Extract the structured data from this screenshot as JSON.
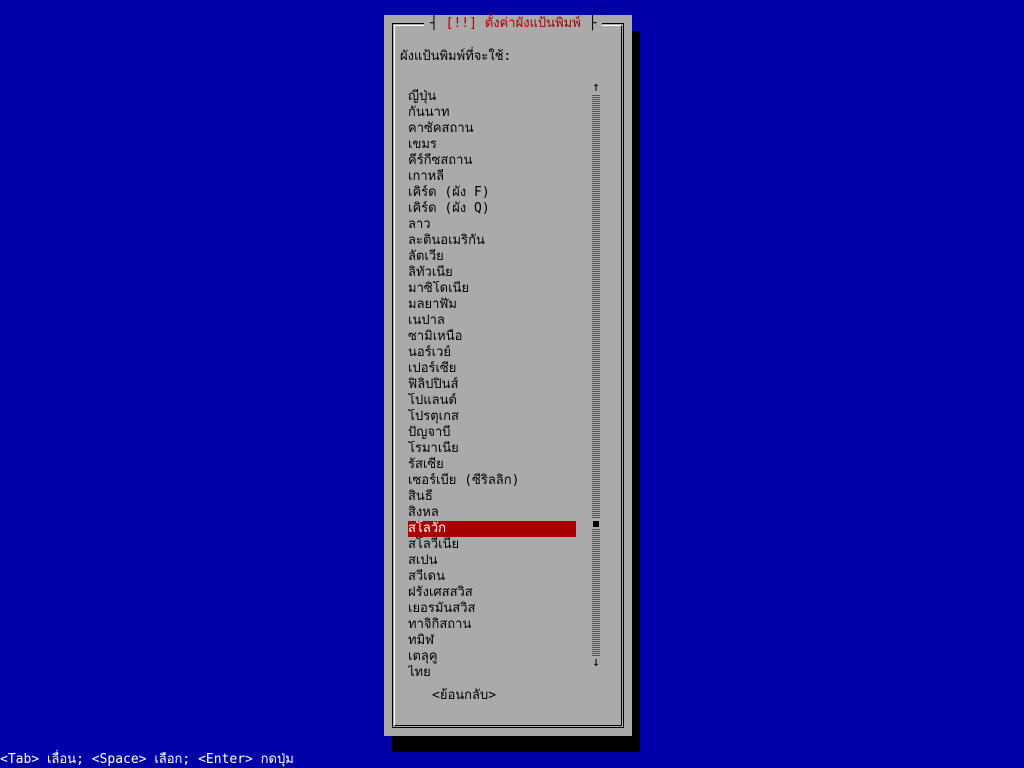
{
  "dialog": {
    "title_prefix": "[!!]",
    "title": "ตั้งค่าผังแป้นพิมพ์",
    "prompt": "ผังแป้นพิมพ์ที่จะใช้:",
    "items": [
      "ญี่ปุ่น",
      "กันนาท",
      "คาซัคสถาน",
      "เขมร",
      "คีร์กีซสถาน",
      "เกาหลี",
      "เคิร์ด (ผัง F)",
      "เคิร์ด (ผัง Q)",
      "ลาว",
      "ละตินอเมริกัน",
      "ลัตเวีย",
      "ลิทัวเนีย",
      "มาซิโดเนีย",
      "มลยาฬัม",
      "เนปาล",
      "ซามิเหนือ",
      "นอร์เวย์",
      "เปอร์เซีย",
      "ฟิลิปปินส์",
      "โปแลนด์",
      "โปรตุเกส",
      "ปัญจาบี",
      "โรมาเนีย",
      "รัสเซีย",
      "เซอร์เบีย (ซีริลลิก)",
      "สินธี",
      "สิงหล",
      "สโลวัก",
      "สโลวีเนีย",
      "สเปน",
      "สวีเดน",
      "ฝรั่งเศสสวิส",
      "เยอรมันสวิส",
      "ทาจิกิสถาน",
      "ทมิฬ",
      "เตลุคู",
      "ไทย"
    ],
    "selected_index": 27,
    "back_label": "<ย้อนกลับ>"
  },
  "scrollbar": {
    "up_arrow": "↑",
    "down_arrow": "↓",
    "position_fraction": 0.77
  },
  "statusbar": {
    "text": "<Tab> เลื่อน; <Space> เลือก; <Enter> กดปุ่ม"
  },
  "colors": {
    "background": "#0000a8",
    "dialog": "#aaaaaa",
    "title_text": "#a80000",
    "selection_bg": "#a80000",
    "selection_fg": "#ffffff",
    "statusbar_text": "#ffffff"
  }
}
